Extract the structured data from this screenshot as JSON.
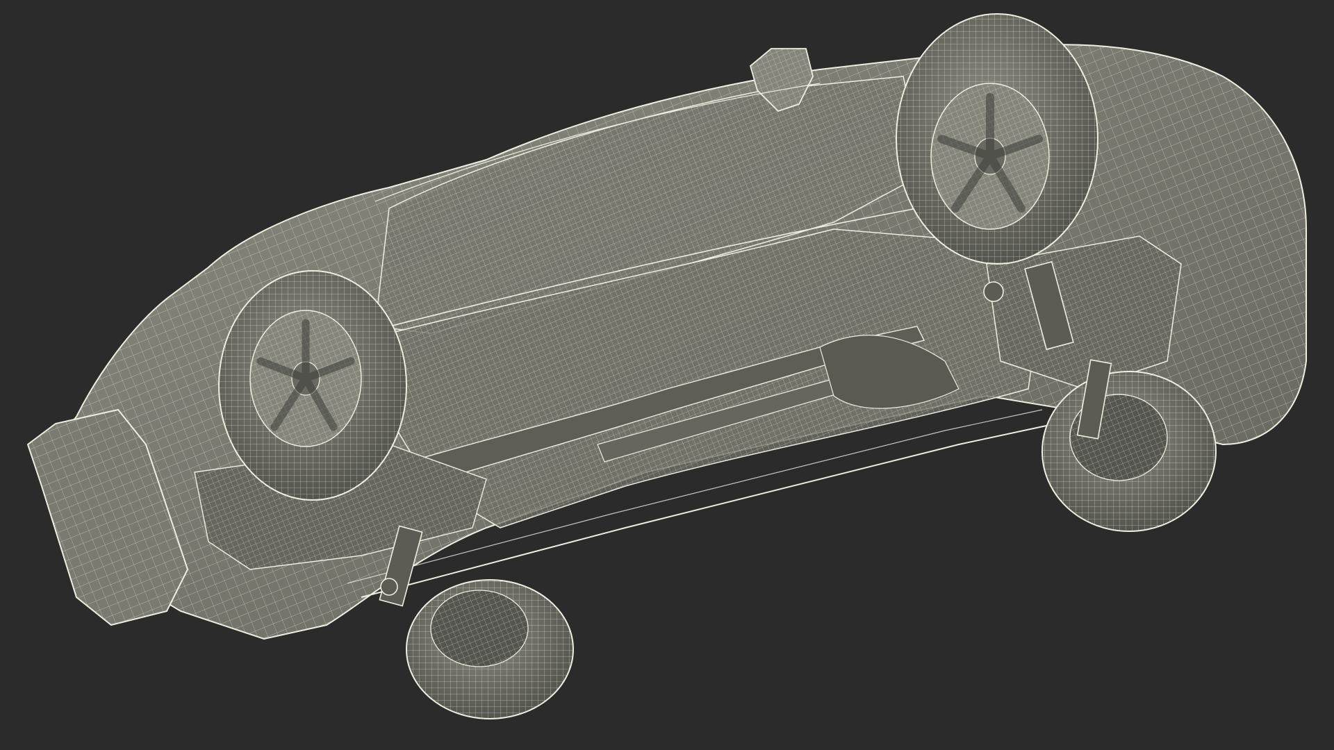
{
  "scene": {
    "subject": "car-underside-wireframe",
    "colors": {
      "background": "#2b2b2b",
      "surface": "#7b7b72",
      "surface_dark": "#5e5e57",
      "surface_shadow": "#4a4a45",
      "wire": "#f1f0e2",
      "wire_faint": "#c9c8b9",
      "tire": "#6a6a63",
      "rim": "#8a8a80"
    },
    "icons": {
      "wheels": [
        "wheel-front-left-icon",
        "wheel-front-right-icon",
        "wheel-rear-left-icon",
        "wheel-rear-right-icon"
      ],
      "body": "car-body-icon"
    }
  }
}
